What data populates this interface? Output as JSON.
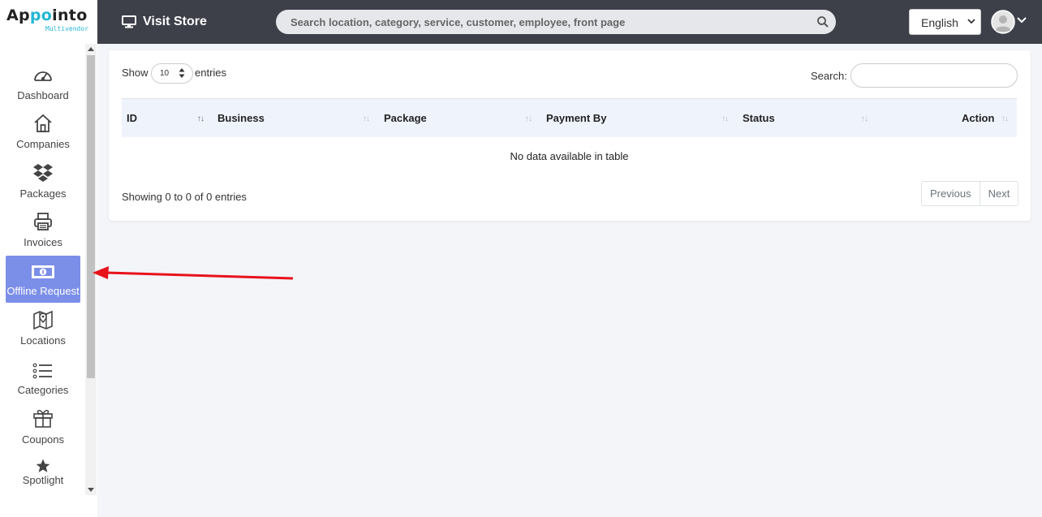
{
  "brand": {
    "name_part1": "Ap",
    "name_part2": "po",
    "name_part3": "into",
    "tagline": "Multivendor",
    "accent_color": "#26b6d8"
  },
  "sidebar": {
    "items": [
      {
        "label": "Dashboard",
        "icon": "gauge-icon"
      },
      {
        "label": "Companies",
        "icon": "home-icon"
      },
      {
        "label": "Packages",
        "icon": "dropbox-icon"
      },
      {
        "label": "Invoices",
        "icon": "printer-icon"
      },
      {
        "label": "Offline Request",
        "icon": "money-bill-icon",
        "active": true
      },
      {
        "label": "Locations",
        "icon": "map-marker-icon"
      },
      {
        "label": "Categories",
        "icon": "list-icon"
      },
      {
        "label": "Coupons",
        "icon": "gift-icon"
      },
      {
        "label": "Spotlight",
        "icon": "star-icon"
      }
    ],
    "active_color": "#7b8ee8"
  },
  "header": {
    "visit_store": "Visit Store",
    "search_placeholder": "Search location, category, service, customer, employee, front page",
    "language": "English",
    "background": "#3d4049"
  },
  "table": {
    "show_label": "Show",
    "entries_value": "10",
    "entries_label": "entries",
    "search_label": "Search:",
    "columns": [
      "ID",
      "Business",
      "Package",
      "Payment By",
      "Status",
      "Action"
    ],
    "empty_message": "No data available in table",
    "info": "Showing 0 to 0 of 0 entries",
    "prev_label": "Previous",
    "next_label": "Next",
    "header_bg": "#eff3fc"
  },
  "annotation": {
    "arrow_color": "#e8121b"
  }
}
